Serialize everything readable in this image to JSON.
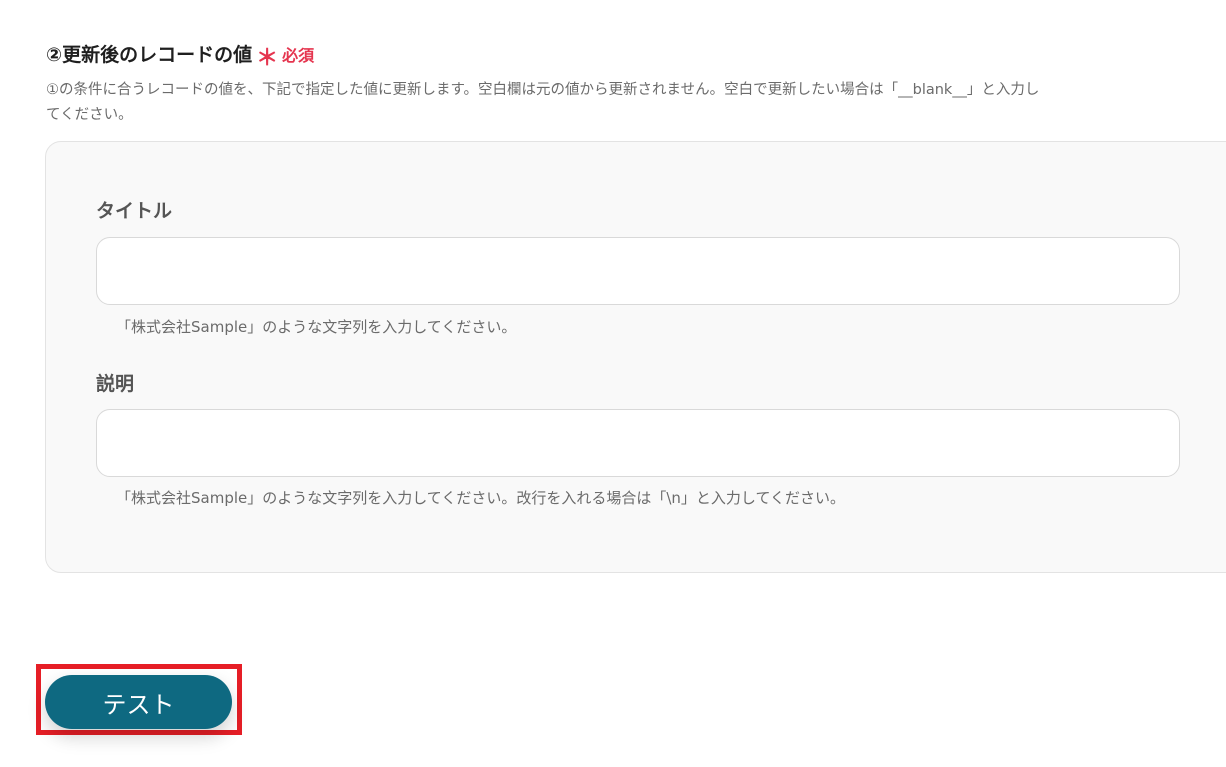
{
  "section": {
    "title": "②更新後のレコードの値",
    "required_mark": "＊",
    "required_label": "必須",
    "description_line1": "①の条件に合うレコードの値を、下記で指定した値に更新します。空白欄は元の値から更新されません。空白で更新したい場合は「__blank__」と入力し",
    "description_line2": "てください。"
  },
  "fields": [
    {
      "label": "タイトル",
      "value": "",
      "help": "「株式会社Sample」のような文字列を入力してください。"
    },
    {
      "label": "説明",
      "value": "",
      "help": "「株式会社Sample」のような文字列を入力してください。改行を入れる場合は「\\n」と入力してください。"
    }
  ],
  "actions": {
    "test_label": "テスト"
  },
  "colors": {
    "required": "#e5354f",
    "primary_button": "#0e6981",
    "highlight_border": "#e61e26"
  }
}
